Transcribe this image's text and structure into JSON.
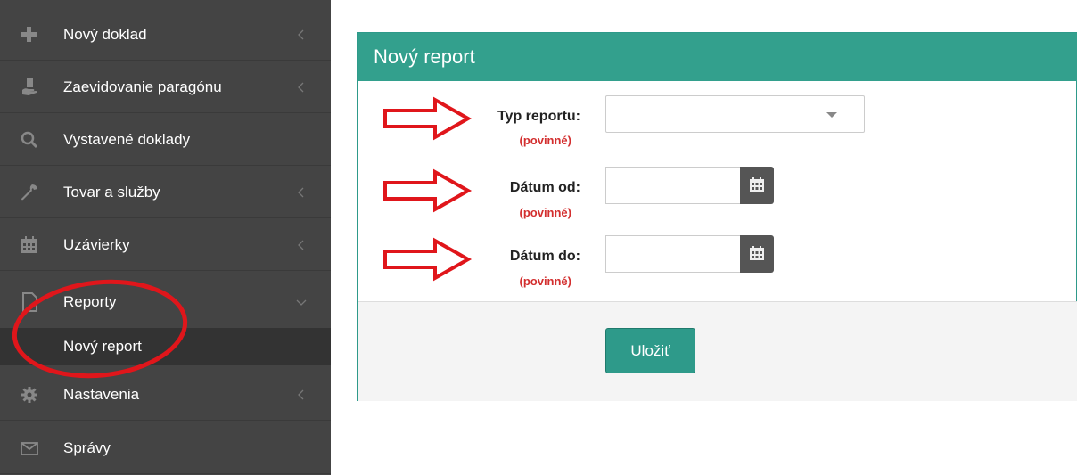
{
  "sidebar": {
    "items": [
      {
        "label": "Nový doklad",
        "icon": "plus-icon"
      },
      {
        "label": "Zaevidovanie paragónu",
        "icon": "receipt-hand-icon"
      },
      {
        "label": "Vystavené doklady",
        "icon": "search-icon"
      },
      {
        "label": "Tovar a služby",
        "icon": "wrench-icon"
      },
      {
        "label": "Uzávierky",
        "icon": "calendar-icon"
      },
      {
        "label": "Reporty",
        "icon": "document-icon"
      },
      {
        "label": "Nastavenia",
        "icon": "gear-icon"
      },
      {
        "label": "Správy",
        "icon": "envelope-icon"
      }
    ],
    "subitem": {
      "label": "Nový report"
    }
  },
  "panel": {
    "title": "Nový report",
    "fields": [
      {
        "label": "Typ reportu:",
        "required": "(povinné)",
        "value": ""
      },
      {
        "label": "Dátum od:",
        "required": "(povinné)",
        "value": ""
      },
      {
        "label": "Dátum do:",
        "required": "(povinné)",
        "value": ""
      }
    ],
    "save_label": "Uložiť"
  },
  "colors": {
    "sidebar_bg": "#444444",
    "sidebar_active_sub": "#333333",
    "accent": "#33a08d",
    "required": "#d32f2f",
    "annotation": "#e0161b"
  }
}
